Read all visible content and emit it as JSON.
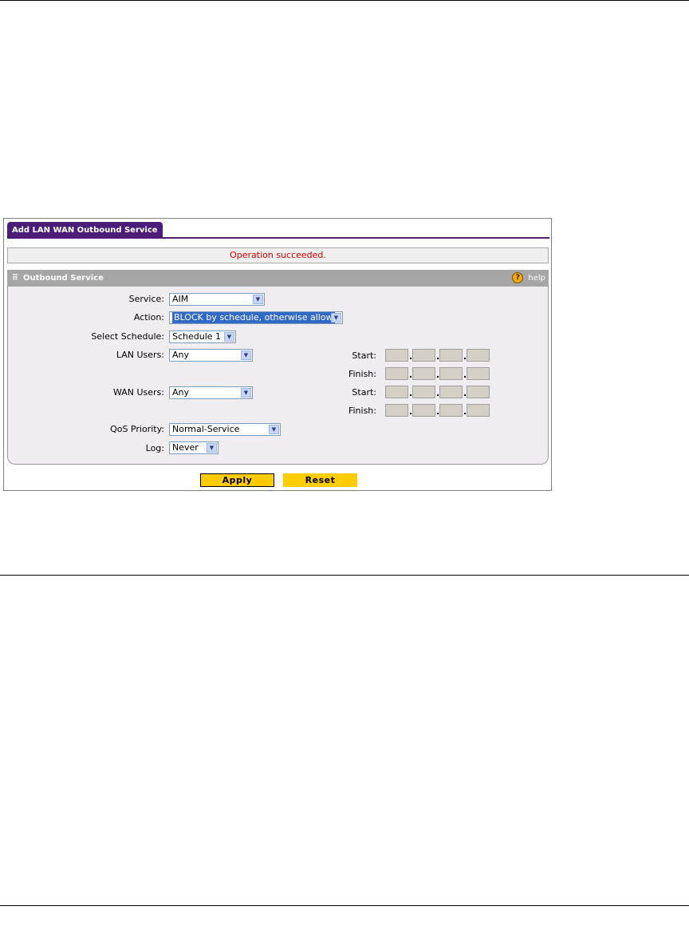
{
  "tab": {
    "label": "Add LAN WAN Outbound Service"
  },
  "message": "Operation succeeded.",
  "panel": {
    "title": "Outbound Service",
    "help_label": "help",
    "help_icon": "?"
  },
  "form": {
    "service": {
      "label": "Service:",
      "value": "AIM"
    },
    "action": {
      "label": "Action:",
      "value": "BLOCK by schedule, otherwise allow"
    },
    "schedule": {
      "label": "Select Schedule:",
      "value": "Schedule 1"
    },
    "lan_users": {
      "label": "LAN Users:",
      "value": "Any",
      "start_label": "Start:",
      "finish_label": "Finish:"
    },
    "wan_users": {
      "label": "WAN Users:",
      "value": "Any",
      "start_label": "Start:",
      "finish_label": "Finish:"
    },
    "qos": {
      "label": "QoS Priority:",
      "value": "Normal-Service"
    },
    "log": {
      "label": "Log:",
      "value": "Never"
    }
  },
  "buttons": {
    "apply": "Apply",
    "reset": "Reset"
  },
  "colors": {
    "tab": "#4c1d78",
    "message": "#e00000",
    "button": "#ffcc00",
    "panel_header": "#a6a6a6"
  }
}
